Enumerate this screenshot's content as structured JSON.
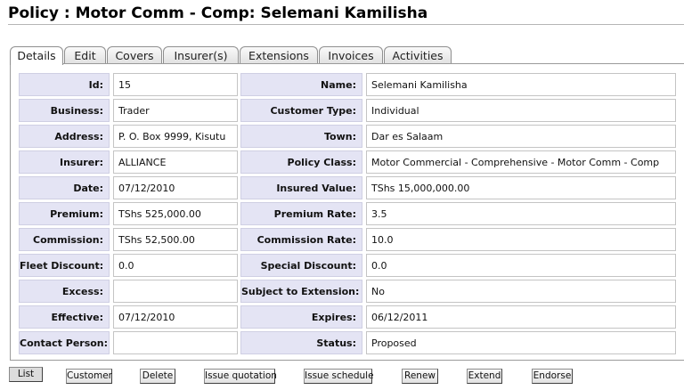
{
  "title": "Policy : Motor Comm - Comp: Selemani Kamilisha",
  "tabs": [
    "Details",
    "Edit",
    "Covers",
    "Insurer(s)",
    "Extensions",
    "Invoices",
    "Activities"
  ],
  "fields": [
    {
      "label": "Id:",
      "value": "15"
    },
    {
      "label": "Name:",
      "value": "Selemani Kamilisha"
    },
    {
      "label": "Business:",
      "value": "Trader"
    },
    {
      "label": "Customer Type:",
      "value": "Individual"
    },
    {
      "label": "Address:",
      "value": "P. O. Box 9999, Kisutu"
    },
    {
      "label": "Town:",
      "value": "Dar es Salaam"
    },
    {
      "label": "Insurer:",
      "value": "ALLIANCE"
    },
    {
      "label": "Policy Class:",
      "value": "Motor Commercial - Comprehensive - Motor Comm - Comp"
    },
    {
      "label": "Date:",
      "value": "07/12/2010"
    },
    {
      "label": "Insured Value:",
      "value": "TShs 15,000,000.00"
    },
    {
      "label": "Premium:",
      "value": "TShs 525,000.00"
    },
    {
      "label": "Premium Rate:",
      "value": "3.5"
    },
    {
      "label": "Commission:",
      "value": "TShs 52,500.00"
    },
    {
      "label": "Commission Rate:",
      "value": "10.0"
    },
    {
      "label": "Fleet Discount:",
      "value": "0.0"
    },
    {
      "label": "Special Discount:",
      "value": "0.0"
    },
    {
      "label": "Excess:",
      "value": ""
    },
    {
      "label": "Subject to Extension:",
      "value": "No"
    },
    {
      "label": "Effective:",
      "value": "07/12/2010"
    },
    {
      "label": "Expires:",
      "value": "06/12/2011"
    },
    {
      "label": "Contact Person:",
      "value": ""
    },
    {
      "label": "Status:",
      "value": "Proposed"
    }
  ],
  "actions": [
    "List",
    "Customer",
    "Delete",
    "Issue quotation",
    "Issue schedule",
    "Renew",
    "Extend",
    "Endorse"
  ]
}
